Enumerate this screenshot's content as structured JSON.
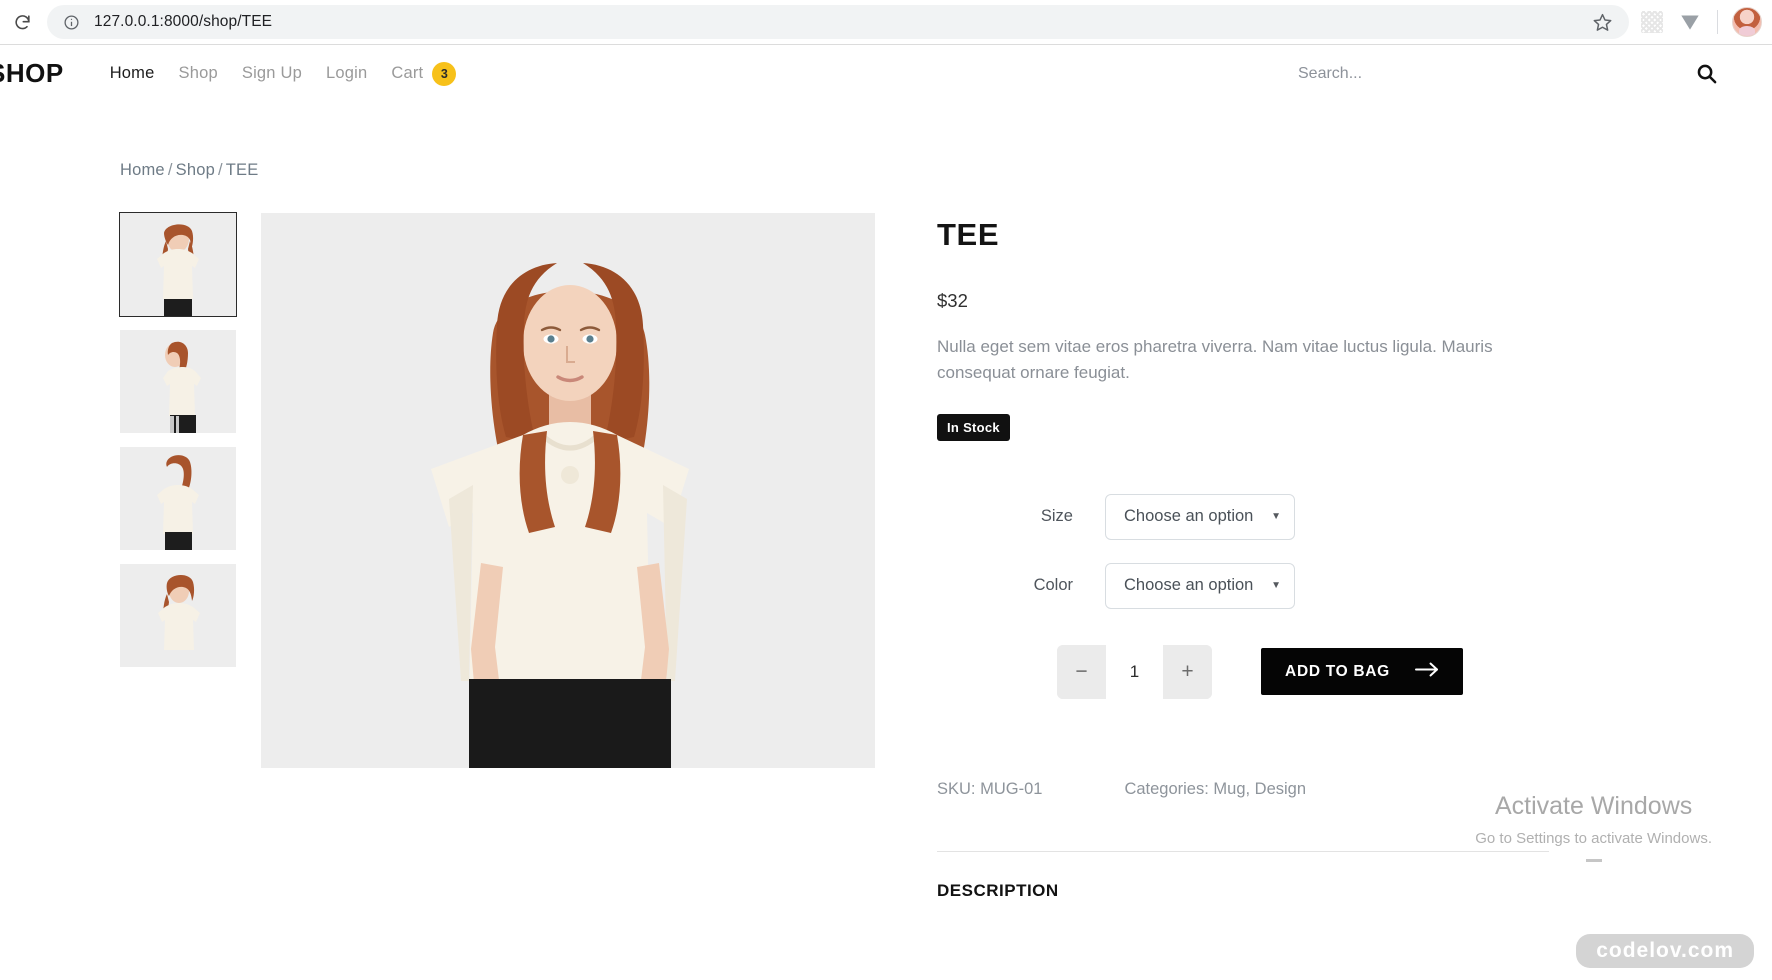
{
  "browser": {
    "reload_icon": "reload-icon",
    "info_icon": "site-info-icon",
    "url": "127.0.0.1:8000/shop/TEE",
    "url_host": "127.0.0.1:8000",
    "url_path": "/shop/TEE",
    "bookmark_icon": "star-icon",
    "extension_icon": "extensions-icon",
    "download_icon": "chevron-down-icon",
    "profile_icon": "avatar"
  },
  "header": {
    "brand": "SHOP",
    "nav": [
      {
        "label": "Home",
        "active": true
      },
      {
        "label": "Shop",
        "active": false
      },
      {
        "label": "Sign Up",
        "active": false
      },
      {
        "label": "Login",
        "active": false
      }
    ],
    "cart": {
      "label": "Cart",
      "count": "3",
      "badge_color": "#f7c11a"
    },
    "search": {
      "placeholder": "Search...",
      "value": "",
      "icon": "search-icon"
    }
  },
  "breadcrumb": {
    "items": [
      "Home",
      "Shop",
      "TEE"
    ],
    "separator": "/"
  },
  "gallery": {
    "thumbnails": [
      {
        "alt": "TEE front view",
        "selected": true
      },
      {
        "alt": "TEE side view",
        "selected": false
      },
      {
        "alt": "TEE back view",
        "selected": false
      },
      {
        "alt": "TEE angled view",
        "selected": false
      }
    ],
    "main_alt": "TEE front view large"
  },
  "product": {
    "title": "TEE",
    "price": "$32",
    "description": "Nulla eget sem vitae eros pharetra viverra. Nam vitae luctus ligula. Mauris consequat ornare feugiat.",
    "stock_status": "In Stock",
    "variations": [
      {
        "label": "Size",
        "value": "Choose an option",
        "caret": "chevron-down-icon"
      },
      {
        "label": "Color",
        "value": "Choose an option",
        "caret": "chevron-down-icon"
      }
    ],
    "quantity": {
      "decrease_label": "−",
      "value": "1",
      "increase_label": "+"
    },
    "add_to_bag": {
      "label": "ADD TO BAG",
      "icon": "arrow-right-icon"
    },
    "sku": "SKU: MUG-01",
    "categories": "Categories: Mug, Design",
    "description_section_title": "DESCRIPTION"
  },
  "watermarks": {
    "activate_title": "Activate Windows",
    "activate_sub": "Go to Settings to activate Windows.",
    "site_tag": "codelov.com"
  }
}
